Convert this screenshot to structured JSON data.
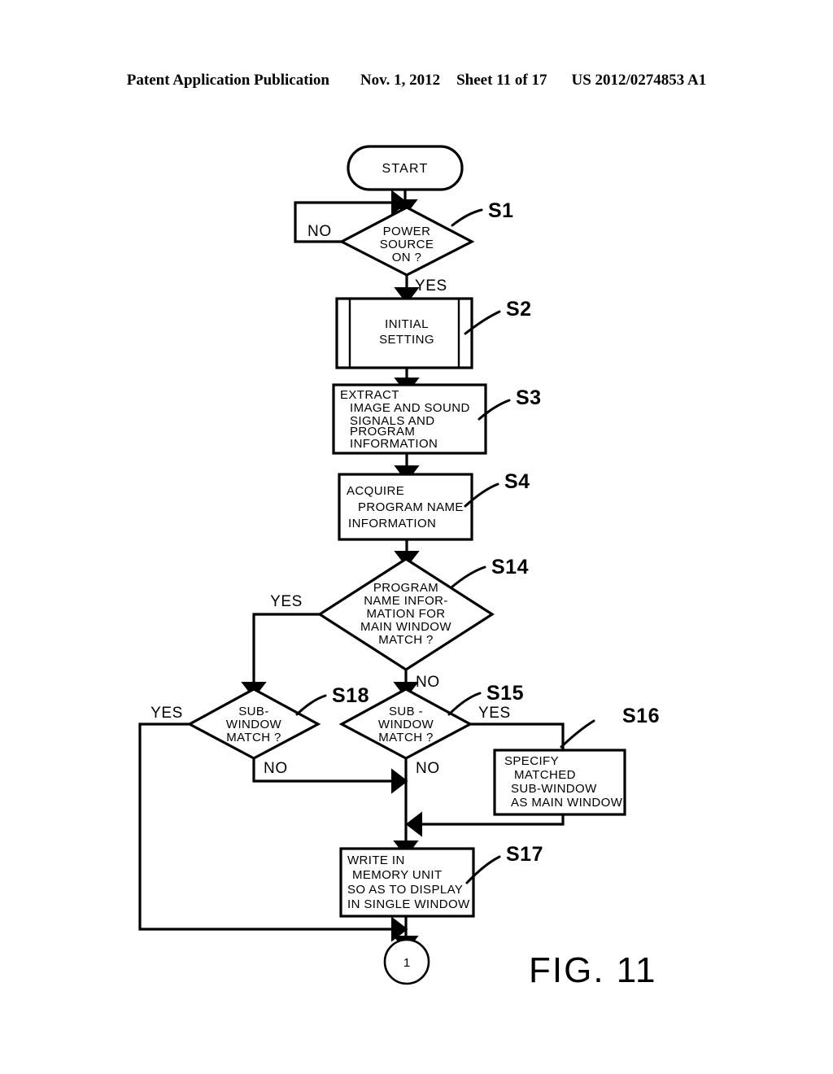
{
  "header": {
    "publication": "Patent Application Publication",
    "date": "Nov. 1, 2012",
    "sheet": "Sheet 11 of 17",
    "patent_number": "US 2012/0274853 A1"
  },
  "figure": {
    "label": "FIG. 11"
  },
  "nodes": {
    "start": {
      "id": "start",
      "type": "terminator",
      "label": "START"
    },
    "s1": {
      "id": "S1",
      "type": "decision",
      "lines": [
        "POWER",
        "SOURCE",
        "ON ?"
      ],
      "step_label": "S1"
    },
    "s2": {
      "id": "S2",
      "type": "predefined-process",
      "lines": [
        "INITIAL",
        "SETTING"
      ],
      "step_label": "S2"
    },
    "s3": {
      "id": "S3",
      "type": "process",
      "lines": [
        "EXTRACT",
        "IMAGE AND SOUND",
        "SIGNALS AND",
        "PROGRAM",
        "INFORMATION"
      ],
      "step_label": "S3"
    },
    "s4": {
      "id": "S4",
      "type": "process",
      "lines": [
        "ACQUIRE",
        "PROGRAM  NAME",
        "INFORMATION"
      ],
      "step_label": "S4"
    },
    "s14": {
      "id": "S14",
      "type": "decision",
      "lines": [
        "PROGRAM",
        "NAME INFOR-",
        "MATION  FOR",
        "MAIN  WINDOW",
        "MATCH ?"
      ],
      "step_label": "S14"
    },
    "s18": {
      "id": "S18",
      "type": "decision",
      "lines": [
        "SUB-",
        "WINDOW",
        "MATCH ?"
      ],
      "step_label": "S18"
    },
    "s15": {
      "id": "S15",
      "type": "decision",
      "lines": [
        "SUB -",
        "WINDOW",
        "MATCH ?"
      ],
      "step_label": "S15"
    },
    "s16": {
      "id": "S16",
      "type": "process",
      "lines": [
        "SPECIFY",
        "MATCHED",
        "SUB-WINDOW",
        "AS MAIN WINDOW"
      ],
      "step_label": "S16"
    },
    "s17": {
      "id": "S17",
      "type": "process",
      "lines": [
        "WRITE IN",
        "MEMORY UNIT",
        "SO AS TO DISPLAY",
        "IN SINGLE WINDOW"
      ],
      "step_label": "S17"
    },
    "connector1": {
      "id": "connector-1",
      "type": "connector",
      "label": "1"
    }
  },
  "branch_labels": {
    "s1_no": "NO",
    "s1_yes": "YES",
    "s14_yes": "YES",
    "s14_no": "NO",
    "s18_yes": "YES",
    "s18_no": "NO",
    "s15_yes": "YES",
    "s15_no": "NO"
  },
  "colors": {
    "ink": "#000000",
    "paper": "#ffffff"
  }
}
